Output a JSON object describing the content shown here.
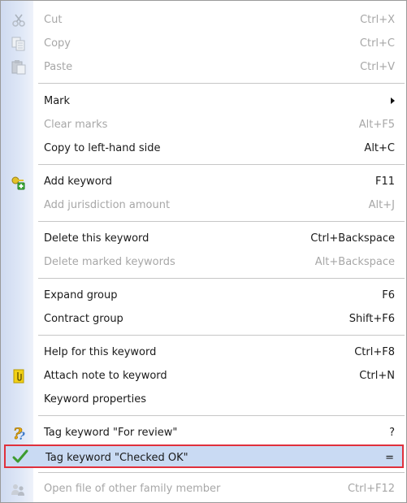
{
  "menu": {
    "items": [
      {
        "label": "Cut",
        "shortcut": "Ctrl+X",
        "icon": "cut-icon",
        "enabled": false
      },
      {
        "label": "Copy",
        "shortcut": "Ctrl+C",
        "icon": "copy-icon",
        "enabled": false
      },
      {
        "label": "Paste",
        "shortcut": "Ctrl+V",
        "icon": "paste-icon",
        "enabled": false
      },
      {
        "label": "Mark",
        "shortcut": "",
        "icon": "submenu-arrow-icon",
        "enabled": true
      },
      {
        "label": "Clear marks",
        "shortcut": "Alt+F5",
        "enabled": false
      },
      {
        "label": "Copy to left-hand side",
        "shortcut": "Alt+C",
        "enabled": true
      },
      {
        "label": "Add keyword",
        "shortcut": "F11",
        "icon": "add-key-icon",
        "enabled": true
      },
      {
        "label": "Add jurisdiction amount",
        "shortcut": "Alt+J",
        "enabled": false
      },
      {
        "label": "Delete this keyword",
        "shortcut": "Ctrl+Backspace",
        "enabled": true
      },
      {
        "label": "Delete marked keywords",
        "shortcut": "Alt+Backspace",
        "enabled": false
      },
      {
        "label": "Expand group",
        "shortcut": "F6",
        "enabled": true
      },
      {
        "label": "Contract group",
        "shortcut": "Shift+F6",
        "enabled": true
      },
      {
        "label": "Help for this keyword",
        "shortcut": "Ctrl+F8",
        "enabled": true
      },
      {
        "label": "Attach note to keyword",
        "shortcut": "Ctrl+N",
        "icon": "note-clip-icon",
        "enabled": true
      },
      {
        "label": "Keyword properties",
        "shortcut": "",
        "enabled": true
      },
      {
        "label": "Tag keyword \"For review\"",
        "shortcut": "?",
        "icon": "question-mark-icon",
        "enabled": true
      },
      {
        "label": "Tag keyword \"Checked OK\"",
        "shortcut": "=",
        "icon": "checkmark-icon",
        "enabled": true,
        "highlighted": true
      },
      {
        "label": "Open file of other family member",
        "shortcut": "Ctrl+F12",
        "icon": "family-members-icon",
        "enabled": false
      }
    ]
  },
  "colors": {
    "highlight_bg": "#c9daf3",
    "highlight_border": "#e0303c",
    "disabled_text": "#a7a7a7",
    "gutter": "#dde6f6"
  }
}
